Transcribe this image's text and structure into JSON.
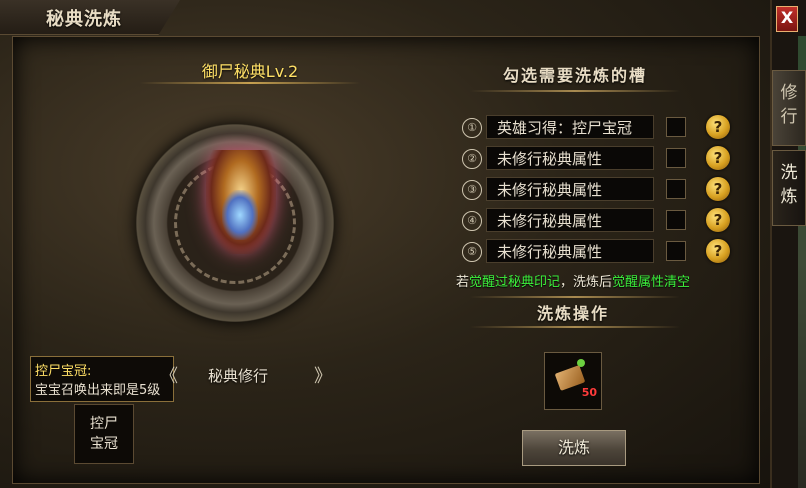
{
  "window": {
    "title": "秘典洗炼",
    "close_label": "X"
  },
  "left_panel": {
    "book_title": "御尸秘典Lv.2",
    "info_box": {
      "title": "控尸宝冠:",
      "description": "宝宝召唤出来即是5级"
    },
    "train_left_chevron": "《",
    "train_label": "秘典修行",
    "train_right_chevron": "》",
    "skill_slot": {
      "line1": "控尸",
      "line2": "宝冠"
    }
  },
  "right_panel": {
    "section_title": "勾选需要洗炼的槽",
    "slots": [
      {
        "num": "①",
        "text": "英雄习得：控尸宝冠",
        "checked": false
      },
      {
        "num": "②",
        "text": "未修行秘典属性",
        "checked": false
      },
      {
        "num": "③",
        "text": "未修行秘典属性",
        "checked": false
      },
      {
        "num": "④",
        "text": "未修行秘典属性",
        "checked": false
      },
      {
        "num": "⑤",
        "text": "未修行秘典属性",
        "checked": false
      }
    ],
    "help_glyph": "?",
    "warning": {
      "p1": "若",
      "hl1": "觉醒过秘典印记",
      "p2": "，洗炼后",
      "hl2": "觉醒属性清空"
    },
    "op_title": "洗炼操作",
    "item": {
      "count": "50",
      "icon": "scroll-icon"
    },
    "refine_button": "洗炼"
  },
  "side_tabs": [
    {
      "label": "修行",
      "active": false
    },
    {
      "label": "洗炼",
      "active": true
    }
  ],
  "colors": {
    "gold_text": "#ffe066",
    "highlight_green": "#3cf03c",
    "count_red": "#ff3b3b"
  }
}
